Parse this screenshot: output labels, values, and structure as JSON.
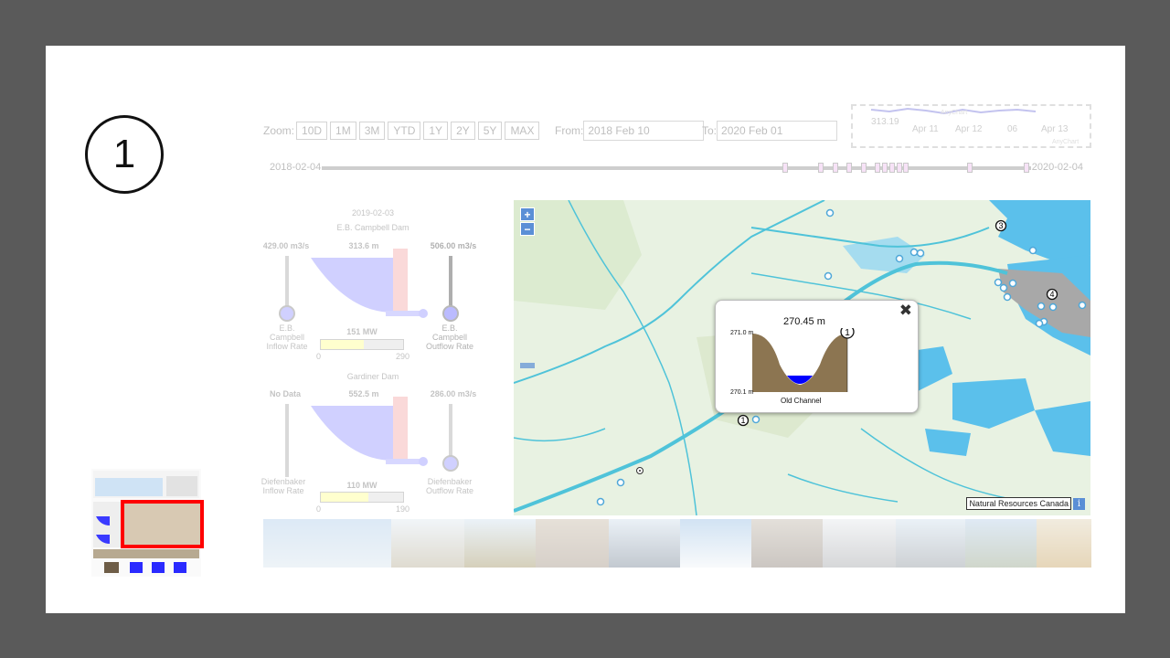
{
  "step": {
    "number": "1"
  },
  "toolbar": {
    "zoom_label": "Zoom:",
    "zoom_buttons": [
      "10D",
      "1M",
      "3M",
      "YTD",
      "1Y",
      "2Y",
      "5Y",
      "MAX"
    ],
    "from_label": "From:",
    "from_value": "2018 Feb 10",
    "to_label": "To:",
    "to_value": "2020 Feb 01"
  },
  "mini_chart": {
    "y_value": "313.19",
    "x_labels": [
      "Apr 11",
      "Apr 12",
      "06",
      "Apr 13"
    ],
    "credit": "AnyChart"
  },
  "timeline": {
    "start": "2018-02-04",
    "end": "2020-02-04",
    "marks": [
      0.65,
      0.7,
      0.72,
      0.74,
      0.76,
      0.78,
      0.79,
      0.8,
      0.81,
      0.82,
      0.91,
      0.99
    ]
  },
  "dam_panel": {
    "date": "2019-02-03",
    "dam1": {
      "name": "E.B. Campbell Dam",
      "inflow": "429.00 m3/s",
      "level": "313.6 m",
      "outflow": "506.00 m3/s",
      "inflow_label_1": "E.B.",
      "inflow_label_2": "Campbell",
      "inflow_label_3": "Inflow Rate",
      "outflow_label_1": "E.B.",
      "outflow_label_2": "Campbell",
      "outflow_label_3": "Outflow Rate",
      "power": "151 MW",
      "power_min": "0",
      "power_max": "290",
      "power_fraction": 0.52
    },
    "dam2": {
      "name": "Gardiner Dam",
      "inflow": "No Data",
      "level": "552.5 m",
      "outflow": "286.00 m3/s",
      "inflow_label_1": "Diefenbaker",
      "inflow_label_2": "Inflow Rate",
      "outflow_label_1": "Diefenbaker",
      "outflow_label_2": "Outflow Rate",
      "power": "110 MW",
      "power_min": "0",
      "power_max": "190",
      "power_fraction": 0.58
    }
  },
  "map": {
    "zoom_in": "+",
    "zoom_out": "−",
    "credit": "Natural Resources Canada",
    "info": "i",
    "markers": [
      "3",
      "4",
      "1"
    ]
  },
  "popup": {
    "value": "270.45 m",
    "y_top": "271.0 m",
    "y_bottom": "270.1 m",
    "caption": "Old Channel",
    "marker": "1",
    "close": "✖"
  },
  "colors": {
    "water": "#5bc0eb",
    "land": "#e8f2e2",
    "river": "#4fc3d9",
    "popup_ground": "#8c7551",
    "popup_water": "#0000ff",
    "highlight": "#ff0000"
  }
}
